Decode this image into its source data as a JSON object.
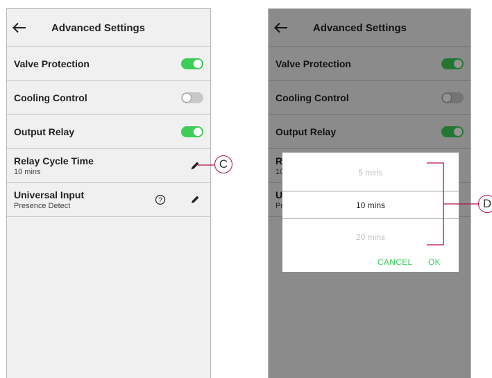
{
  "left_screen": {
    "title": "Advanced Settings",
    "rows": [
      {
        "label": "Valve Protection",
        "toggle": "on"
      },
      {
        "label": "Cooling Control",
        "toggle": "off"
      },
      {
        "label": "Output Relay",
        "toggle": "on"
      },
      {
        "label": "Relay Cycle Time",
        "sub": "10 mins"
      },
      {
        "label": "Universal Input",
        "sub": "Presence Detect"
      }
    ]
  },
  "right_screen": {
    "title": "Advanced Settings",
    "rows": [
      {
        "label": "Valve Protection",
        "toggle": "on"
      },
      {
        "label": "Cooling Control",
        "toggle": "off"
      },
      {
        "label": "Output Relay",
        "toggle": "on"
      },
      {
        "label": "Re",
        "sub": "10"
      },
      {
        "label": "Un",
        "sub": "Pr"
      }
    ]
  },
  "picker": {
    "options": [
      "5 mins",
      "10 mins",
      "20 mins"
    ],
    "selected": "10 mins",
    "cancel_label": "CANCEL",
    "ok_label": "OK"
  },
  "callouts": {
    "c": "C",
    "d": "D"
  },
  "colors": {
    "accent": "#3dcd58",
    "callout": "#b0124a",
    "toggle_off": "#c8c8c8"
  },
  "icons": {
    "back": "arrow-left-icon",
    "edit": "pencil-icon",
    "help": "question-circle-icon"
  }
}
